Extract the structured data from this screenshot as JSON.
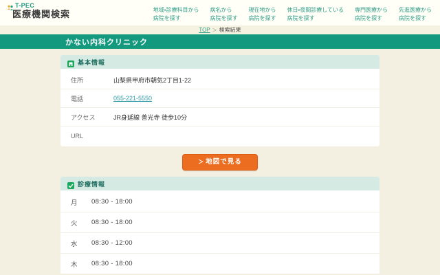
{
  "brand": {
    "name": "T-PEC",
    "subtitle": "医療機関検索"
  },
  "nav": {
    "items": [
      {
        "line1": "地域・診療科目から",
        "line2": "病院を探す"
      },
      {
        "line1": "病名から",
        "line2": "病院を探す"
      },
      {
        "line1": "現在地から",
        "line2": "病院を探す"
      },
      {
        "line1": "休日・夜間診療している",
        "line2": "病院を探す"
      },
      {
        "line1": "専門医療から",
        "line2": "病院を探す"
      },
      {
        "line1": "先進医療から",
        "line2": "病院を探す"
      }
    ]
  },
  "breadcrumb": {
    "home": "TOP",
    "separator": "＞",
    "current": "検索結果"
  },
  "page": {
    "title": "かない内科クリニック"
  },
  "basic_info": {
    "heading": "基本情報",
    "rows": [
      {
        "label": "住所",
        "value": "山梨県甲府市朝気2丁目1-22"
      },
      {
        "label": "電話",
        "value": "055-221-5550"
      },
      {
        "label": "アクセス",
        "value": "JR身延線 善光寺 徒歩10分"
      },
      {
        "label": "URL",
        "value": ""
      }
    ]
  },
  "map_button": {
    "arrow": "＞",
    "label": "地図で見る"
  },
  "clinic_hours": {
    "heading": "診療情報",
    "rows": [
      {
        "day": "月",
        "hours": "08:30 - 18:00"
      },
      {
        "day": "火",
        "hours": "08:30 - 18:00"
      },
      {
        "day": "水",
        "hours": "08:30 - 12:00"
      },
      {
        "day": "木",
        "hours": "08:30 - 18:00"
      }
    ]
  },
  "colors": {
    "brand_teal": "#13997e",
    "nav_text": "#2f9e88",
    "card_header_bg": "#d6eae4",
    "section_icon_green": "#1ba75c",
    "button_orange": "#ec6d1f",
    "link_color": "#2b97a4",
    "page_bg": "#f3efe1"
  }
}
